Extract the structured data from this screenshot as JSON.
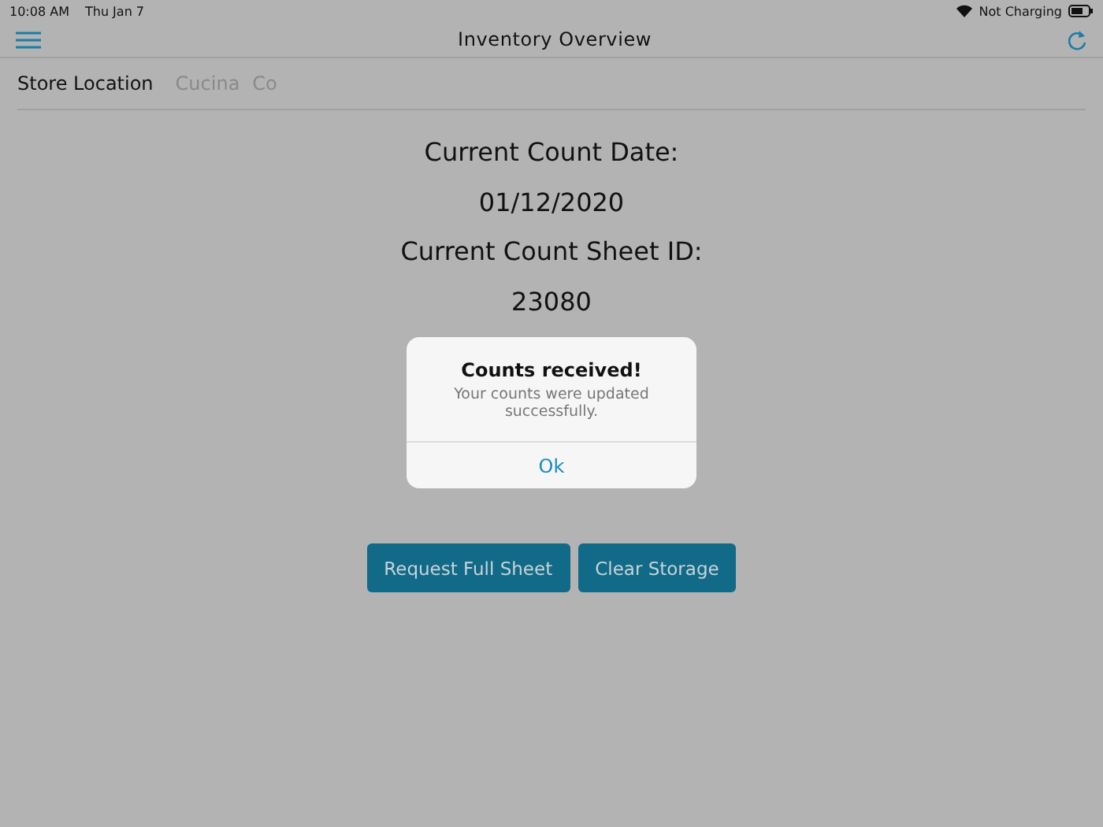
{
  "status_bar": {
    "time": "10:08 AM",
    "date": "Thu Jan 7",
    "charging": "Not Charging"
  },
  "nav_bar": {
    "title": "Inventory Overview"
  },
  "store_location": {
    "label": "Store Location",
    "values": [
      "Cucina",
      "Co"
    ]
  },
  "count_info": [
    "Current Count Date:",
    "01/12/2020",
    "Current Count Sheet ID:",
    "23080"
  ],
  "buttons": [
    "Request Full Sheet",
    "Clear Storage"
  ],
  "dialog": {
    "title": "Counts received!",
    "message": "Your counts were updated successfully.",
    "action": "Ok"
  }
}
